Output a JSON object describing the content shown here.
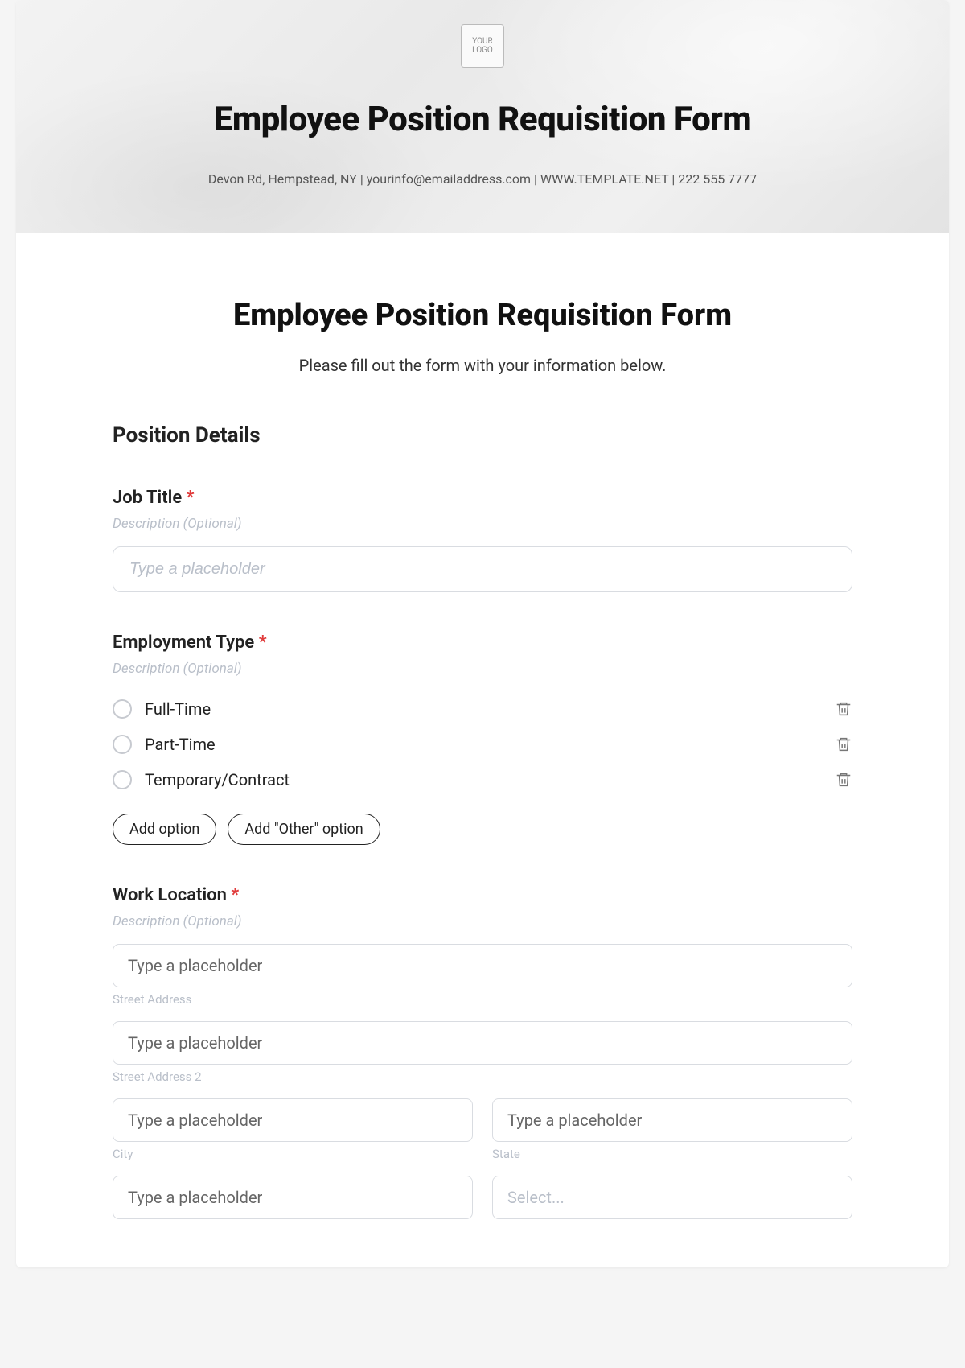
{
  "hero": {
    "logo_text": "YOUR\nLOGO",
    "title": "Employee Position Requisition Form",
    "contact": "Devon Rd, Hempstead, NY | yourinfo@emailaddress.com | WWW.TEMPLATE.NET | 222 555 7777"
  },
  "form": {
    "title": "Employee Position Requisition Form",
    "subtitle": "Please fill out the form with your information below."
  },
  "section1": {
    "heading": "Position Details"
  },
  "job_title": {
    "label": "Job Title",
    "required_mark": "*",
    "desc_placeholder": "Description (Optional)",
    "input_placeholder": "Type a placeholder"
  },
  "employment_type": {
    "label": "Employment Type",
    "required_mark": "*",
    "desc_placeholder": "Description (Optional)",
    "options": [
      "Full-Time",
      "Part-Time",
      "Temporary/Contract"
    ],
    "add_option_label": "Add option",
    "add_other_label": "Add \"Other\" option"
  },
  "work_location": {
    "label": "Work Location",
    "required_mark": "*",
    "desc_placeholder": "Description (Optional)",
    "placeholder": "Type a placeholder",
    "sublabels": {
      "street1": "Street Address",
      "street2": "Street Address 2",
      "city": "City",
      "state": "State"
    },
    "select_placeholder": "Select..."
  }
}
